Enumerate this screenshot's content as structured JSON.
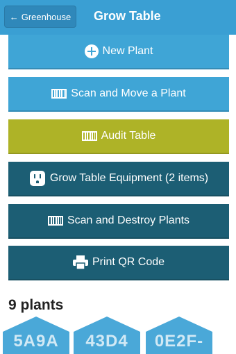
{
  "header": {
    "back_label": "Greenhouse",
    "title": "Grow Table"
  },
  "actions": [
    {
      "label": "New Plant",
      "icon": "plus-circle-icon",
      "color": "#3fa5d6"
    },
    {
      "label": "Scan and Move a Plant",
      "icon": "barcode-icon",
      "color": "#3fa5d6"
    },
    {
      "label": "Audit Table",
      "icon": "barcode-icon",
      "color": "#aeb327"
    },
    {
      "label": "Grow Table Equipment (2 items)",
      "icon": "outlet-icon",
      "color": "#1c5e74"
    },
    {
      "label": "Scan and Destroy Plants",
      "icon": "barcode-icon",
      "color": "#1c5e74"
    },
    {
      "label": "Print QR Code",
      "icon": "printer-icon",
      "color": "#1c5e74"
    }
  ],
  "plants": {
    "heading": "9 plants",
    "tiles": [
      {
        "code": "5A9A",
        "color": "#4aa8d8"
      },
      {
        "code": "43D4",
        "color": "#4aa8d8"
      },
      {
        "code": "0E2F-",
        "color": "#4aa8d8"
      }
    ]
  }
}
